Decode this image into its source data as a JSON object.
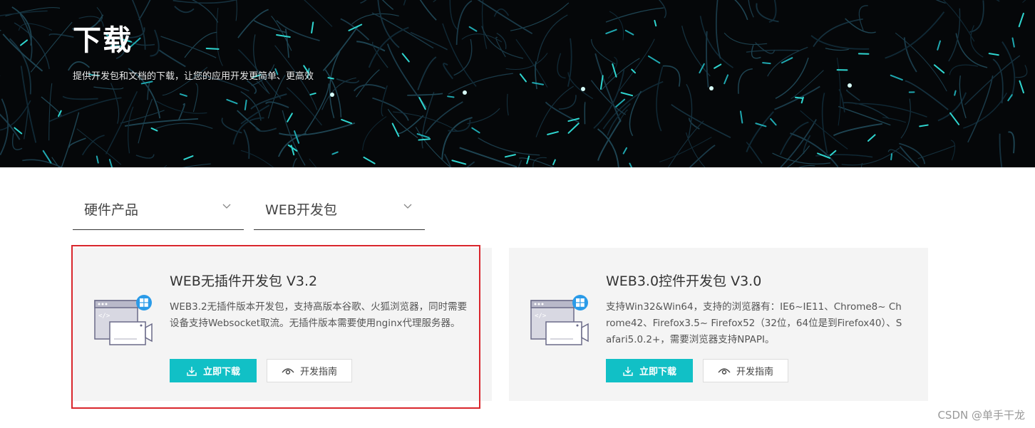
{
  "banner": {
    "title": "下载",
    "subtitle": "提供开发包和文档的下载，让您的应用开发更简单、更高效"
  },
  "filters": [
    {
      "label": "硬件产品"
    },
    {
      "label": "WEB开发包"
    }
  ],
  "cards": [
    {
      "title": "WEB无插件开发包 V3.2",
      "description": "WEB3.2无插件版本开发包，支持高版本谷歌、火狐浏览器，同时需要设备支持Websocket取流。无插件版本需要使用nginx代理服务器。",
      "download_label": "立即下载",
      "guide_label": "开发指南",
      "highlighted": true
    },
    {
      "title": "WEB3.0控件开发包 V3.0",
      "description": "支持Win32&Win64，支持的浏览器有：IE6~IE11、Chrome8~ Chrome42、Firefox3.5~ Firefox52（32位，64位是到Firefox40）、Safari5.0.2+，需要浏览器支持NPAPI。",
      "download_label": "立即下载",
      "guide_label": "开发指南",
      "highlighted": false
    }
  ],
  "watermark": "CSDN @单手干龙",
  "colors": {
    "accent": "#11c0c6",
    "highlight_border": "#d9262c",
    "banner_bg": "#050709",
    "card_bg": "#f4f4f4"
  },
  "icons": [
    "chevron-down-icon",
    "download-icon",
    "eye-icon",
    "windows-icon",
    "browser-video-icon"
  ]
}
